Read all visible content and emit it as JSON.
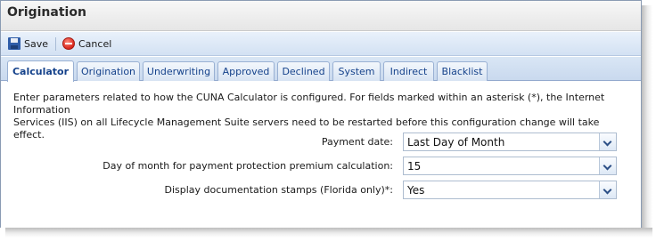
{
  "window": {
    "title": "Origination"
  },
  "toolbar": {
    "save_label": "Save",
    "cancel_label": "Cancel"
  },
  "tabs": [
    {
      "label": "Calculator",
      "active": true
    },
    {
      "label": "Origination"
    },
    {
      "label": "Underwriting"
    },
    {
      "label": "Approved"
    },
    {
      "label": "Declined"
    },
    {
      "label": "System"
    },
    {
      "label": "Indirect"
    },
    {
      "label": "Blacklist"
    }
  ],
  "description": {
    "line1": "Enter parameters related to how the CUNA Calculator is configured. For fields marked within an asterisk (*), the Internet Information",
    "line2": "Services (IIS) on all Lifecycle Management Suite servers need to be restarted before this configuration change will take effect."
  },
  "fields": {
    "payment_date": {
      "label": "Payment date:",
      "value": "Last Day of Month"
    },
    "day_of_month": {
      "label": "Day of month for payment protection premium calculation:",
      "value": "15"
    },
    "doc_stamps": {
      "label": "Display documentation stamps (Florida only)*:",
      "value": "Yes"
    }
  },
  "icons": {
    "save": "floppy-disk-icon",
    "cancel": "no-entry-icon",
    "dropdown": "chevron-down-icon"
  }
}
